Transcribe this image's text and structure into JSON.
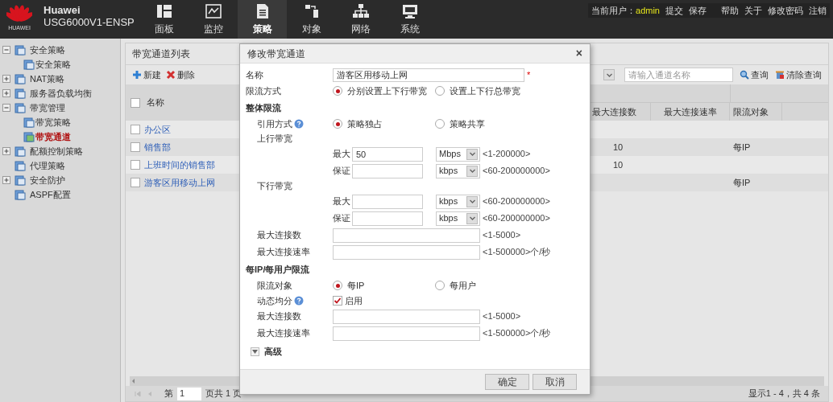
{
  "header": {
    "logo_text": "HUAWEI",
    "brand": "Huawei",
    "model": "USG6000V1-ENSP",
    "nav": [
      {
        "label": "面板",
        "kind": "dashboard",
        "selected": false
      },
      {
        "label": "监控",
        "kind": "monitor",
        "selected": false
      },
      {
        "label": "策略",
        "kind": "policy",
        "selected": true
      },
      {
        "label": "对象",
        "kind": "object",
        "selected": false
      },
      {
        "label": "网络",
        "kind": "network",
        "selected": false
      },
      {
        "label": "系统",
        "kind": "system",
        "selected": false
      }
    ],
    "user_label": "当前用户：",
    "user": "admin",
    "actions": [
      "提交",
      "保存"
    ],
    "links": [
      "帮助",
      "关于",
      "修改密码",
      "注销"
    ]
  },
  "sidebar": {
    "items": [
      {
        "label": "安全策略",
        "kind": "folder",
        "expanded": true,
        "selected": false,
        "children": [
          {
            "label": "安全策略",
            "selected": false
          }
        ]
      },
      {
        "label": "NAT策略",
        "kind": "folder",
        "expanded": false,
        "selected": false
      },
      {
        "label": "服务器负载均衡",
        "kind": "folder",
        "expanded": false,
        "selected": false
      },
      {
        "label": "带宽管理",
        "kind": "folder",
        "expanded": true,
        "selected": false,
        "children": [
          {
            "label": "带宽策略",
            "selected": false
          },
          {
            "label": "带宽通道",
            "selected": true
          }
        ]
      },
      {
        "label": "配额控制策略",
        "kind": "folder",
        "expanded": false,
        "selected": false
      },
      {
        "label": "代理策略",
        "kind": "leaf",
        "selected": false
      },
      {
        "label": "安全防护",
        "kind": "folder",
        "expanded": false,
        "selected": false
      },
      {
        "label": "ASPF配置",
        "kind": "leaf",
        "selected": false
      }
    ]
  },
  "list": {
    "title": "带宽通道列表",
    "toolbar": [
      {
        "label": "新建",
        "kind": "add"
      },
      {
        "label": "删除",
        "kind": "delete"
      }
    ],
    "search": {
      "placeholder": "请输入通道名称"
    },
    "search_actions": [
      {
        "label": "查询",
        "kind": "search"
      },
      {
        "label": "清除查询",
        "kind": "clear"
      }
    ],
    "table": {
      "header_checked": false,
      "columns": [
        "名称",
        "最大连接数",
        "最大连接速率",
        "限流对象"
      ],
      "rows": [
        {
          "checked": false,
          "cells": [
            "办公区",
            "",
            "",
            ""
          ]
        },
        {
          "checked": false,
          "cells": [
            "销售部",
            "10",
            "",
            "每IP"
          ]
        },
        {
          "checked": false,
          "cells": [
            "上班时间的销售部",
            "10",
            "",
            ""
          ]
        },
        {
          "checked": false,
          "cells": [
            "游客区用移动上网",
            "",
            "",
            "每IP"
          ]
        }
      ]
    },
    "pager": {
      "page_label": "第",
      "page": "1",
      "total_label": "页共 1 页",
      "summary": "显示1 - 4，共 4 条"
    }
  },
  "dialog": {
    "title": "修改带宽通道",
    "close": "×",
    "rows": [
      {
        "kind": "text",
        "label": "名称",
        "value": "游客区用移动上网",
        "required": "*"
      },
      {
        "kind": "radio",
        "label": "限流方式",
        "options": [
          {
            "label": "分别设置上下行带宽",
            "selected": true
          },
          {
            "label": "设置上下行总带宽",
            "selected": false
          }
        ]
      },
      {
        "kind": "section",
        "label": "整体限流",
        "rows": [
          {
            "kind": "radio",
            "label": "引用方式",
            "help": true,
            "options": [
              {
                "label": "策略独占",
                "selected": true
              },
              {
                "label": "策略共享",
                "selected": false
              }
            ]
          },
          {
            "kind": "group",
            "label": "上行带宽",
            "rows": [
              {
                "kind": "bandwidth",
                "label": "最大",
                "value": "50",
                "unit": "Mbps",
                "hint": "<1-200000>"
              },
              {
                "kind": "bandwidth",
                "label": "保证",
                "value": "",
                "unit": "kbps",
                "hint": "<60-200000000>"
              }
            ]
          },
          {
            "kind": "group",
            "label": "下行带宽",
            "rows": [
              {
                "kind": "bandwidth",
                "label": "最大",
                "value": "",
                "unit": "kbps",
                "hint": "<60-200000000>"
              },
              {
                "kind": "bandwidth",
                "label": "保证",
                "value": "",
                "unit": "kbps",
                "hint": "<60-200000000>"
              }
            ]
          },
          {
            "kind": "input",
            "label": "最大连接数",
            "value": "",
            "hint": "<1-5000>"
          },
          {
            "kind": "input",
            "label": "最大连接速率",
            "value": "",
            "hint": "<1-500000>个/秒"
          }
        ]
      },
      {
        "kind": "section",
        "label": "每IP/每用户限流",
        "rows": [
          {
            "kind": "radio",
            "label": "限流对象",
            "options": [
              {
                "label": "每IP",
                "selected": true
              },
              {
                "label": "每用户",
                "selected": false
              }
            ]
          },
          {
            "kind": "checkbox",
            "label": "动态均分",
            "help": true,
            "text": "启用",
            "checked": true
          },
          {
            "kind": "input",
            "label": "最大连接数",
            "value": "",
            "hint": "<1-5000>"
          },
          {
            "kind": "input",
            "label": "最大连接速率",
            "value": "",
            "hint": "<1-500000>个/秒"
          }
        ]
      },
      {
        "kind": "expander",
        "label": "高级",
        "expanded": false
      }
    ],
    "buttons": [
      "确定",
      "取消"
    ]
  }
}
